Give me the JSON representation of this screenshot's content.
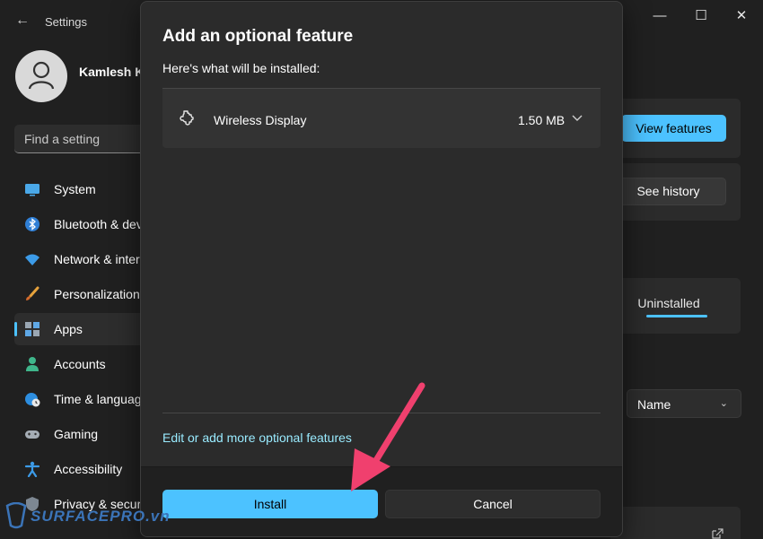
{
  "window": {
    "title": "Settings",
    "controls": {
      "minimize": "—",
      "maximize": "☐",
      "close": "✕"
    }
  },
  "profile": {
    "name": "Kamlesh Ku"
  },
  "search": {
    "placeholder": "Find a setting"
  },
  "sidebar": {
    "items": [
      {
        "label": "System",
        "icon": "monitor-icon"
      },
      {
        "label": "Bluetooth & dev",
        "icon": "bluetooth-icon"
      },
      {
        "label": "Network & inter",
        "icon": "wifi-icon"
      },
      {
        "label": "Personalization",
        "icon": "brush-icon"
      },
      {
        "label": "Apps",
        "icon": "apps-icon",
        "active": true
      },
      {
        "label": "Accounts",
        "icon": "person-icon"
      },
      {
        "label": "Time & languag",
        "icon": "globe-clock-icon"
      },
      {
        "label": "Gaming",
        "icon": "gamepad-icon"
      },
      {
        "label": "Accessibility",
        "icon": "accessibility-icon"
      },
      {
        "label": "Privacy & securi",
        "icon": "shield-icon"
      }
    ]
  },
  "background": {
    "view_features": "View features",
    "see_history": "See history",
    "tab_uninstalled": "Uninstalled",
    "sort_value": "Name"
  },
  "dialog": {
    "title": "Add an optional feature",
    "subtitle": "Here's what will be installed:",
    "feature": {
      "name": "Wireless Display",
      "size": "1.50 MB",
      "icon": "puzzle-gear-icon"
    },
    "link": "Edit or add more optional features",
    "install_label": "Install",
    "cancel_label": "Cancel"
  },
  "watermark": {
    "text": "SURFACEPRO.vn"
  },
  "colors": {
    "accent": "#4cc2ff",
    "link": "#99ebff",
    "annotation": "#f0406e"
  }
}
